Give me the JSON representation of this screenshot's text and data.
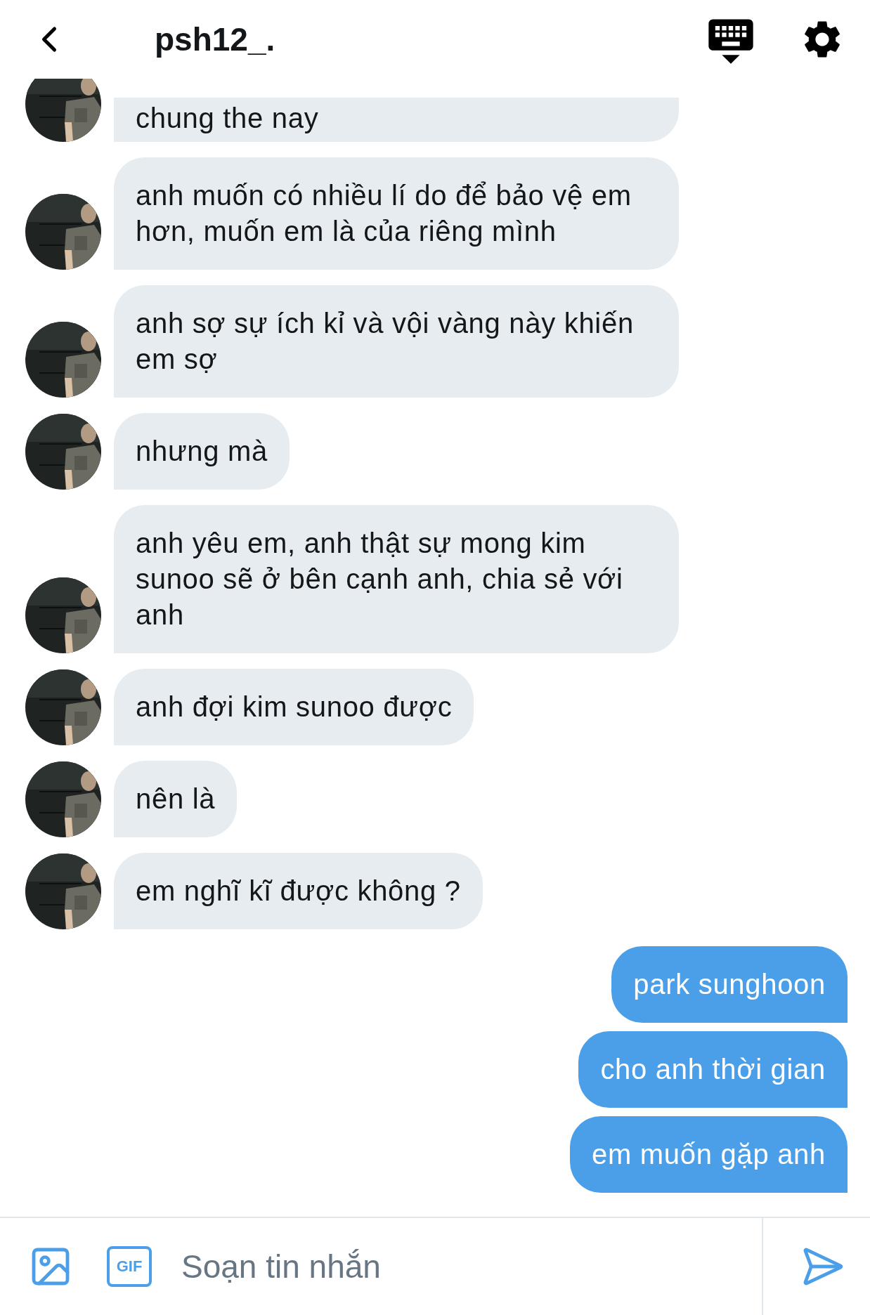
{
  "header": {
    "title": "psh12_."
  },
  "messages": [
    {
      "kind": "received",
      "text": "chung the nay"
    },
    {
      "kind": "received",
      "text": "anh muốn có nhiều lí do để bảo vệ em hơn, muốn em là của riêng mình"
    },
    {
      "kind": "received",
      "text": "anh sợ sự ích kỉ và vội vàng này khiến em sợ"
    },
    {
      "kind": "received",
      "text": "nhưng mà"
    },
    {
      "kind": "received",
      "text": "anh yêu em, anh thật sự mong kim sunoo sẽ ở bên cạnh anh, chia sẻ với anh"
    },
    {
      "kind": "received",
      "text": "anh đợi kim sunoo được"
    },
    {
      "kind": "received",
      "text": "nên là"
    },
    {
      "kind": "received",
      "text": "em nghĩ kĩ được không ?"
    },
    {
      "kind": "sent",
      "text": "park sunghoon"
    },
    {
      "kind": "sent",
      "text": "cho anh thời gian"
    },
    {
      "kind": "sent",
      "text": "em muốn gặp anh"
    }
  ],
  "composer": {
    "gif_label": "GIF",
    "placeholder": "Soạn tin nhắn"
  }
}
